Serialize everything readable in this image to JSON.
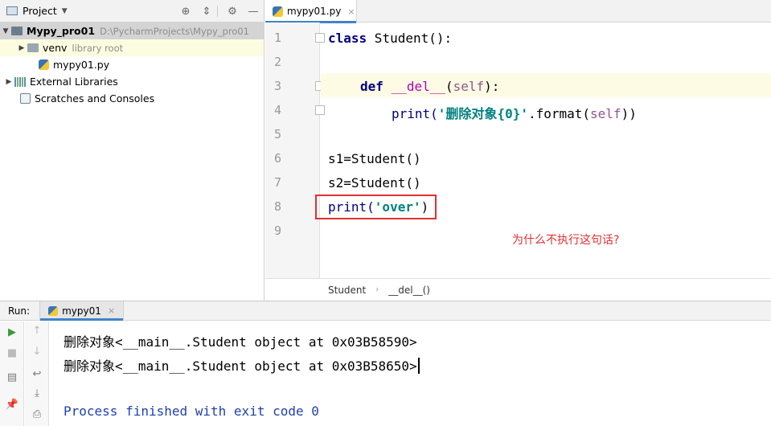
{
  "project_panel": {
    "title": "Project",
    "header_icons": [
      "crosshair-icon",
      "collapse-icon",
      "gear-icon",
      "hide-icon"
    ],
    "tree": [
      {
        "name": "Mypy_pro01",
        "path": "D:\\PycharmProjects\\Mypy_pro01"
      },
      {
        "name": "venv",
        "note": "library root"
      },
      {
        "name": "mypy01.py"
      },
      {
        "name": "External Libraries"
      },
      {
        "name": "Scratches and Consoles"
      }
    ]
  },
  "editor": {
    "tab_label": "mypy01.py",
    "line_numbers": [
      "1",
      "2",
      "3",
      "4",
      "5",
      "6",
      "7",
      "8",
      "9"
    ],
    "code": {
      "l1_kw": "class",
      "l1_rest": " Student():",
      "l3_kw": "def",
      "l3_fn": "__del__",
      "l3_open": "(",
      "l3_self": "self",
      "l3_close": "):",
      "l4_print": "print(",
      "l4_str": "'删除对象{0}'",
      "l4_mid": ".format(",
      "l4_self": "self",
      "l4_end": "))",
      "l6": "s1=Student()",
      "l7": "s2=Student()",
      "l8_print": "print(",
      "l8_str": "'over'",
      "l8_end": ")"
    },
    "annotation": "为什么不执行这句话?",
    "breadcrumb": [
      "Student",
      "__del__()"
    ],
    "highlight_color": "#e03131"
  },
  "run_panel": {
    "label": "Run:",
    "tab_label": "mypy01",
    "output": [
      "删除对象<__main__.Student object at 0x03B58590>",
      "删除对象<__main__.Student object at 0x03B58650>",
      "",
      "Process finished with exit code 0"
    ]
  }
}
